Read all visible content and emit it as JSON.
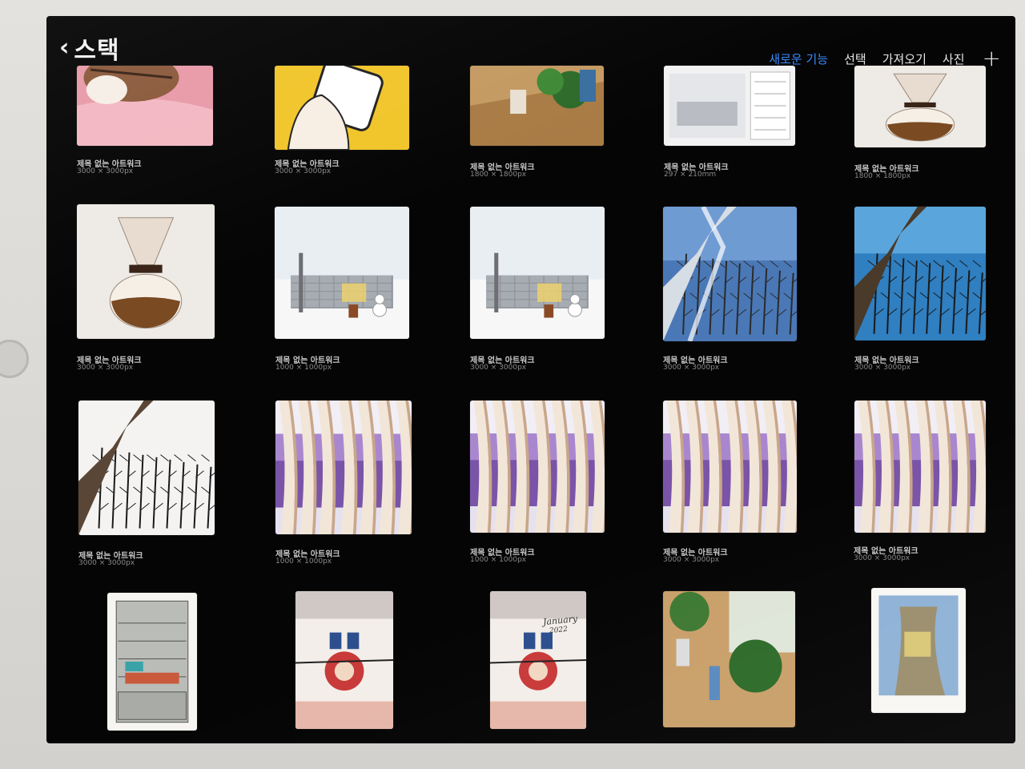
{
  "header": {
    "back_icon": "chevron-left-icon",
    "title": "스택"
  },
  "toolbar": {
    "whats_new": "새로운 기능",
    "select": "선택",
    "import": "가져오기",
    "photo": "사진",
    "plus_icon": "plus-icon",
    "plus_glyph": "+",
    "accent_color": "#3a8bff"
  },
  "artworks": [
    {
      "title": "제목 없는 아트워크",
      "size": "3000 × 3000px",
      "art": "pink-cat"
    },
    {
      "title": "제목 없는 아트워크",
      "size": "3000 × 3000px",
      "art": "yellow-phone"
    },
    {
      "title": "제목 없는 아트워크",
      "size": "1800 × 1800px",
      "art": "plants-floor"
    },
    {
      "title": "제목 없는 아트워크",
      "size": "297 × 210mm",
      "art": "wall-sketch-sheet"
    },
    {
      "title": "제목 없는 아트워크",
      "size": "1800 × 1800px",
      "art": "coffee-dripper"
    },
    {
      "title": "제목 없는 아트워크",
      "size": "3000 × 3000px",
      "art": "coffee-dripper-large"
    },
    {
      "title": "제목 없는 아트워크",
      "size": "1000 × 1000px",
      "art": "snow-wall"
    },
    {
      "title": "제목 없는 아트워크",
      "size": "3000 × 3000px",
      "art": "snow-wall"
    },
    {
      "title": "제목 없는 아트워크",
      "size": "3000 × 3000px",
      "art": "snowy-tree"
    },
    {
      "title": "제목 없는 아트워크",
      "size": "3000 × 3000px",
      "art": "blue-sky-tree"
    },
    {
      "title": "제목 없는 아트워크",
      "size": "3000 × 3000px",
      "art": "white-sky-tree"
    },
    {
      "title": "제목 없는 아트워크",
      "size": "1000 × 1000px",
      "art": "purple-birch"
    },
    {
      "title": "제목 없는 아트워크",
      "size": "1000 × 1000px",
      "art": "purple-birch"
    },
    {
      "title": "제목 없는 아트워크",
      "size": "3000 × 3000px",
      "art": "purple-birch"
    },
    {
      "title": "제목 없는 아트워크",
      "size": "3000 × 3000px",
      "art": "purple-birch"
    },
    {
      "title": "",
      "size": "",
      "art": "cabinet"
    },
    {
      "title": "",
      "size": "",
      "art": "sled-kids"
    },
    {
      "title": "",
      "size": "",
      "art": "sled-calendar"
    },
    {
      "title": "",
      "size": "",
      "art": "plants-window"
    },
    {
      "title": "",
      "size": "",
      "art": "old-tree"
    }
  ],
  "calendar_text": {
    "month": "January",
    "year": "2022"
  }
}
